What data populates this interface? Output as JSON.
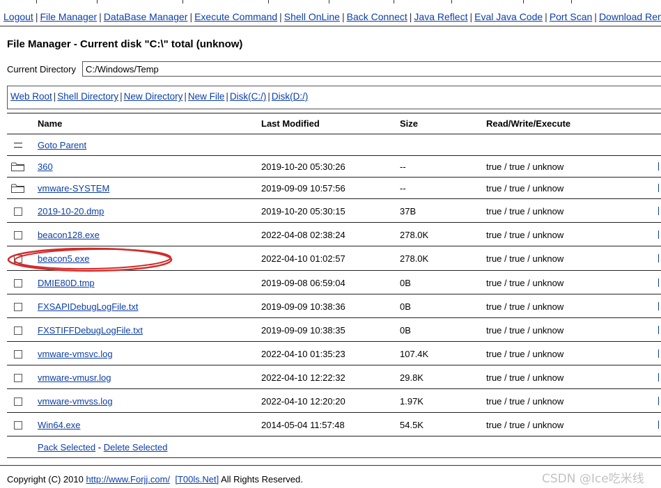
{
  "nav": {
    "items": [
      "Logout",
      "File Manager",
      "DataBase Manager",
      "Execute Command",
      "Shell OnLine",
      "Back Connect",
      "Java Reflect",
      "Eval Java Code",
      "Port Scan",
      "Download Remote Fi"
    ]
  },
  "title": "File Manager - Current disk \"C:\\\" total (unknow)",
  "current_directory": {
    "label": "Current Directory",
    "value": "C:/Windows/Temp"
  },
  "toolbar": {
    "items": [
      "Web Root",
      "Shell Directory",
      "New Directory",
      "New File",
      "Disk(C:/)",
      "Disk(D:/)"
    ]
  },
  "table": {
    "headers": {
      "name": "Name",
      "modified": "Last Modified",
      "size": "Size",
      "perms": "Read/Write/Execute"
    },
    "goto_parent": "Goto Parent",
    "rows": [
      {
        "type": "folder",
        "name": "360",
        "modified": "2019-10-20 05:30:26",
        "size": "--",
        "perms": "true / true / unknow"
      },
      {
        "type": "folder",
        "name": "vmware-SYSTEM",
        "modified": "2019-09-09 10:57:56",
        "size": "--",
        "perms": "true / true / unknow"
      },
      {
        "type": "file",
        "name": "2019-10-20.dmp",
        "modified": "2019-10-20 05:30:15",
        "size": "37B",
        "perms": "true / true / unknow"
      },
      {
        "type": "file",
        "name": "beacon128.exe",
        "modified": "2022-04-08 02:38:24",
        "size": "278.0K",
        "perms": "true / true / unknow"
      },
      {
        "type": "file",
        "name": "beacon5.exe",
        "modified": "2022-04-10 01:02:57",
        "size": "278.0K",
        "perms": "true / true / unknow",
        "highlighted": true
      },
      {
        "type": "file",
        "name": "DMIE80D.tmp",
        "modified": "2019-09-08 06:59:04",
        "size": "0B",
        "perms": "true / true / unknow"
      },
      {
        "type": "file",
        "name": "FXSAPIDebugLogFile.txt",
        "modified": "2019-09-09 10:38:36",
        "size": "0B",
        "perms": "true / true / unknow"
      },
      {
        "type": "file",
        "name": "FXSTIFFDebugLogFile.txt",
        "modified": "2019-09-09 10:38:35",
        "size": "0B",
        "perms": "true / true / unknow"
      },
      {
        "type": "file",
        "name": "vmware-vmsvc.log",
        "modified": "2022-04-10 01:35:23",
        "size": "107.4K",
        "perms": "true / true / unknow"
      },
      {
        "type": "file",
        "name": "vmware-vmusr.log",
        "modified": "2022-04-10 12:22:32",
        "size": "29.8K",
        "perms": "true / true / unknow"
      },
      {
        "type": "file",
        "name": "vmware-vmvss.log",
        "modified": "2022-04-10 12:20:20",
        "size": "1.97K",
        "perms": "true / true / unknow"
      },
      {
        "type": "file",
        "name": "Win64.exe",
        "modified": "2014-05-04 11:57:48",
        "size": "54.5K",
        "perms": "true / true / unknow"
      }
    ]
  },
  "actions": {
    "pack": "Pack Selected",
    "delete": "Delete Selected",
    "separator": "-"
  },
  "footer": {
    "prefix": "Copyright (C) 2010",
    "link1": "http://www.Forjj.com/",
    "link2": "[T00ls.Net]",
    "suffix": "All Rights Reserved."
  },
  "watermark": "CSDN @Ice吃米线",
  "colors": {
    "link": "#0b3ea8",
    "annotation": "#d42a2a"
  }
}
